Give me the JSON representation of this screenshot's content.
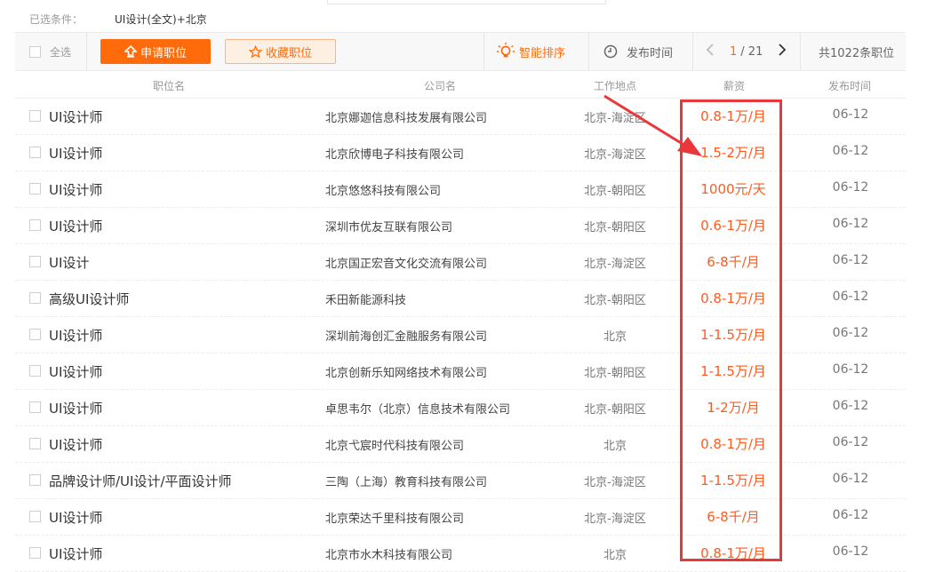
{
  "filter": {
    "label": "已选条件：",
    "value": "UI设计(全文)+北京"
  },
  "toolbar": {
    "select_all": "全选",
    "apply": "申请职位",
    "favorite": "收藏职位",
    "smart_sort": "智能排序",
    "publish_time": "发布时间",
    "page_current": "1",
    "page_total": "/ 21",
    "total": "共1022条职位"
  },
  "columns": [
    "职位名",
    "公司名",
    "工作地点",
    "薪资",
    "发布时间"
  ],
  "rows": [
    {
      "title": "UI设计师",
      "company": "北京娜迦信息科技发展有限公司",
      "location": "北京-海淀区",
      "salary": "0.8-1万/月",
      "date": "06-12"
    },
    {
      "title": "UI设计师",
      "company": "北京欣博电子科技有限公司",
      "location": "北京-海淀区",
      "salary": "1.5-2万/月",
      "date": "06-12"
    },
    {
      "title": "UI设计师",
      "company": "北京悠悠科技有限公司",
      "location": "北京-朝阳区",
      "salary": "1000元/天",
      "date": "06-12"
    },
    {
      "title": "UI设计师",
      "company": "深圳市优友互联有限公司",
      "location": "北京-朝阳区",
      "salary": "0.6-1万/月",
      "date": "06-12"
    },
    {
      "title": "UI设计",
      "company": "北京国正宏音文化交流有限公司",
      "location": "北京-海淀区",
      "salary": "6-8千/月",
      "date": "06-12"
    },
    {
      "title": "高级UI设计师",
      "company": "禾田新能源科技",
      "location": "北京-朝阳区",
      "salary": "0.8-1万/月",
      "date": "06-12"
    },
    {
      "title": "UI设计师",
      "company": "深圳前海创汇金融服务有限公司",
      "location": "北京",
      "salary": "1-1.5万/月",
      "date": "06-12"
    },
    {
      "title": "UI设计师",
      "company": "北京创新乐知网络技术有限公司",
      "location": "北京-朝阳区",
      "salary": "1-1.5万/月",
      "date": "06-12"
    },
    {
      "title": "UI设计师",
      "company": "卓思韦尔（北京）信息技术有限公司",
      "location": "北京-朝阳区",
      "salary": "1-2万/月",
      "date": "06-12"
    },
    {
      "title": "UI设计师",
      "company": "北京弋宸时代科技有限公司",
      "location": "北京",
      "salary": "0.8-1万/月",
      "date": "06-12"
    },
    {
      "title": "品牌设计师/UI设计/平面设计师",
      "company": "三陶（上海）教育科技有限公司",
      "location": "北京-海淀区",
      "salary": "1-1.5万/月",
      "date": "06-12"
    },
    {
      "title": "UI设计师",
      "company": "北京荣达千里科技有限公司",
      "location": "北京-海淀区",
      "salary": "6-8千/月",
      "date": "06-12"
    },
    {
      "title": "UI设计师",
      "company": "北京市水木科技有限公司",
      "location": "北京",
      "salary": "0.8-1万/月",
      "date": "06-12"
    }
  ],
  "colors": {
    "accent": "#ff6b0a",
    "salary": "#ff5a1e",
    "annotation": "#e8383b"
  }
}
